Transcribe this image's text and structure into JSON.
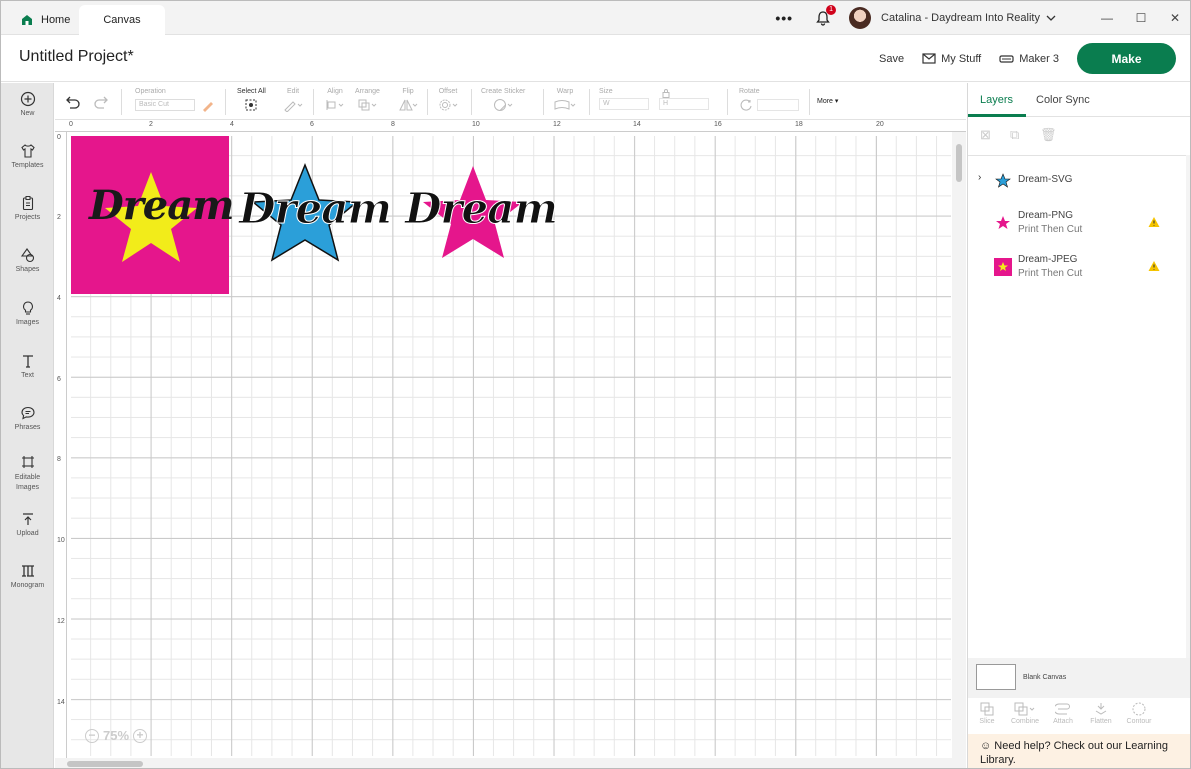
{
  "titlebar": {
    "tabs": [
      {
        "label": "Home"
      },
      {
        "label": "Canvas"
      }
    ],
    "notification_count": "1",
    "user_name": "Catalina - Daydream Into Reality"
  },
  "header": {
    "project_title": "Untitled Project*",
    "save_label": "Save",
    "my_stuff_label": "My Stuff",
    "machine_label": "Maker 3",
    "make_label": "Make"
  },
  "sidebar": {
    "items": [
      {
        "label": "New"
      },
      {
        "label": "Templates"
      },
      {
        "label": "Projects"
      },
      {
        "label": "Shapes"
      },
      {
        "label": "Images"
      },
      {
        "label": "Text"
      },
      {
        "label": "Phrases"
      },
      {
        "label": "Editable Images"
      },
      {
        "label": "Upload"
      },
      {
        "label": "Monogram"
      }
    ]
  },
  "toolbar": {
    "operation_label": "Operation",
    "operation_value": "Basic Cut",
    "select_all_label": "Select All",
    "edit_label": "Edit",
    "align_label": "Align",
    "arrange_label": "Arrange",
    "flip_label": "Flip",
    "offset_label": "Offset",
    "create_sticker_label": "Create Sticker",
    "warp_label": "Warp",
    "size_label": "Size",
    "size_w": "W",
    "size_h": "H",
    "rotate_label": "Rotate",
    "more_label": "More"
  },
  "canvas": {
    "ruler_top": [
      "0",
      "2",
      "4",
      "6",
      "8",
      "10",
      "12",
      "14",
      "16",
      "18",
      "20"
    ],
    "ruler_left": [
      "0",
      "2",
      "4",
      "6",
      "8",
      "10",
      "12",
      "14"
    ],
    "zoom": "75%",
    "design_text": "Dream",
    "colors": {
      "magenta": "#e5168c",
      "yellow": "#f2ec1a",
      "blue": "#2b9fd9"
    }
  },
  "right_panel": {
    "tabs": [
      {
        "label": "Layers"
      },
      {
        "label": "Color Sync"
      }
    ],
    "layers": [
      {
        "name": "Dream-SVG",
        "sub": ""
      },
      {
        "name": "Dream-PNG",
        "sub": "Print Then Cut"
      },
      {
        "name": "Dream-JPEG",
        "sub": "Print Then Cut"
      }
    ],
    "blank_canvas_label": "Blank Canvas",
    "bottom_tools": [
      {
        "label": "Slice"
      },
      {
        "label": "Combine"
      },
      {
        "label": "Attach"
      },
      {
        "label": "Flatten"
      },
      {
        "label": "Contour"
      }
    ],
    "help_text": "Need help? Check out our Learning Library."
  }
}
